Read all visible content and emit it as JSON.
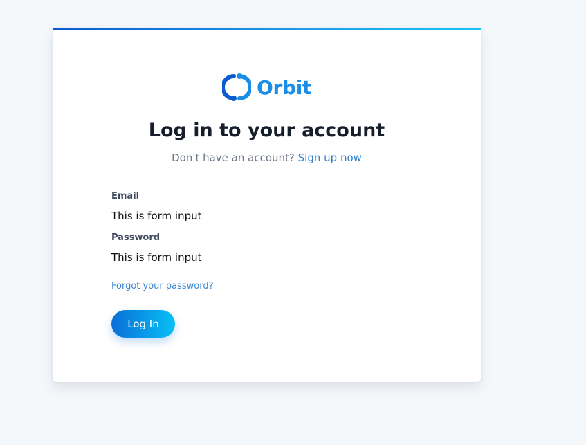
{
  "brand": {
    "name": "Orbit",
    "icon": "orbit-logo-icon",
    "color": "#1a8de6"
  },
  "heading": {
    "title": "Log in to your account",
    "prompt": "Don't have an account?",
    "signup_link": "Sign up now"
  },
  "form": {
    "email_label": "Email",
    "email_value": "This is form input",
    "password_label": "Password",
    "password_value": "This is form input",
    "forgot_link": "Forgot your password?",
    "submit_label": "Log In"
  },
  "colors": {
    "accent": "#2f7fd1",
    "button_start": "#0a6fd8",
    "button_end": "#07c0f6",
    "background": "#f5f8fb"
  }
}
